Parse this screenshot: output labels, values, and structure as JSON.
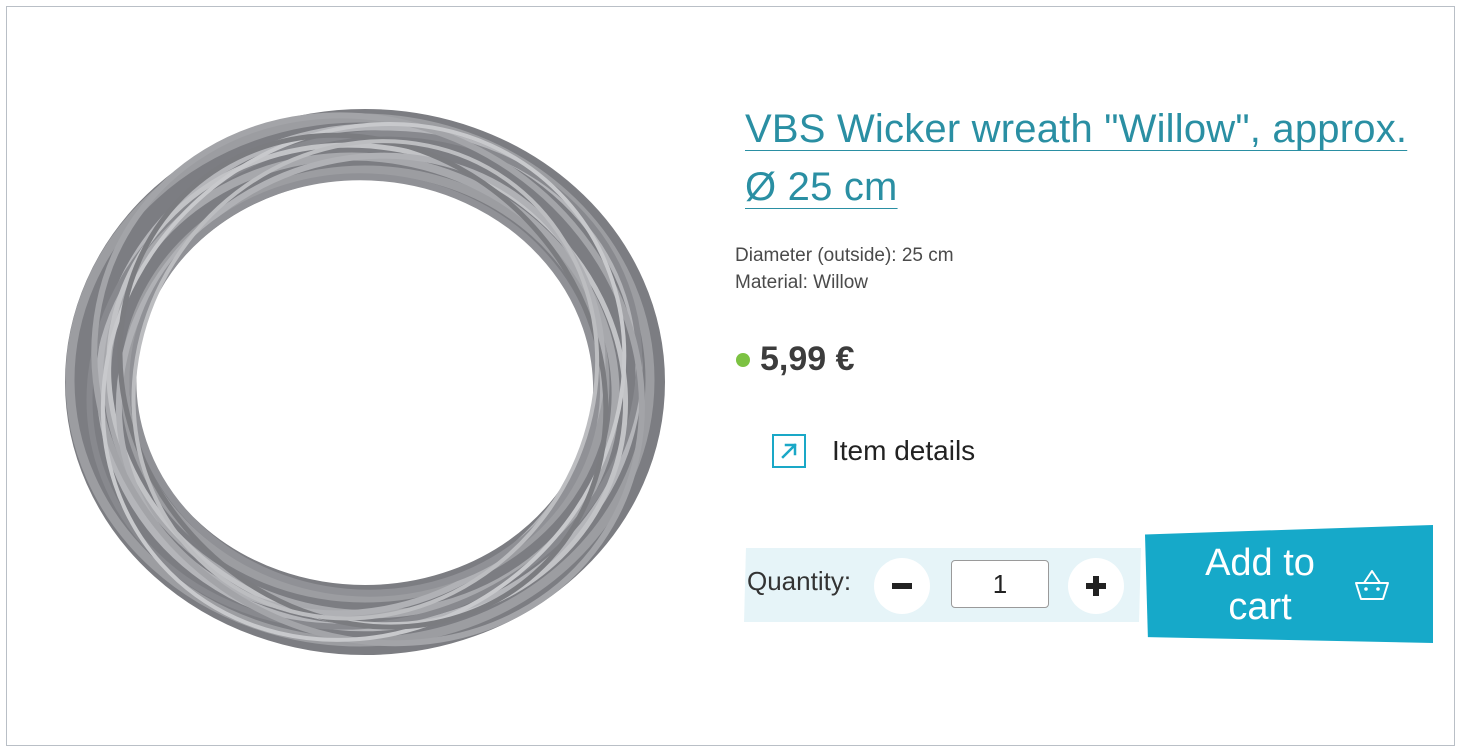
{
  "product": {
    "title": "VBS Wicker wreath \"Willow\", approx. Ø 25 cm",
    "specs": {
      "diameter": "Diameter (outside): 25 cm",
      "material": "Material: Willow"
    },
    "price": "5,99 €",
    "stock_color": "#7cc242"
  },
  "details_link": {
    "label": "Item details",
    "icon": "external-link-arrow-icon"
  },
  "quantity": {
    "label": "Quantity:",
    "value": "1",
    "decrement_icon": "minus-icon",
    "increment_icon": "plus-icon"
  },
  "cart": {
    "label": "Add to cart",
    "icon": "basket-icon",
    "color": "#16a9c9"
  },
  "image": {
    "icon": "wicker-wreath-image"
  }
}
